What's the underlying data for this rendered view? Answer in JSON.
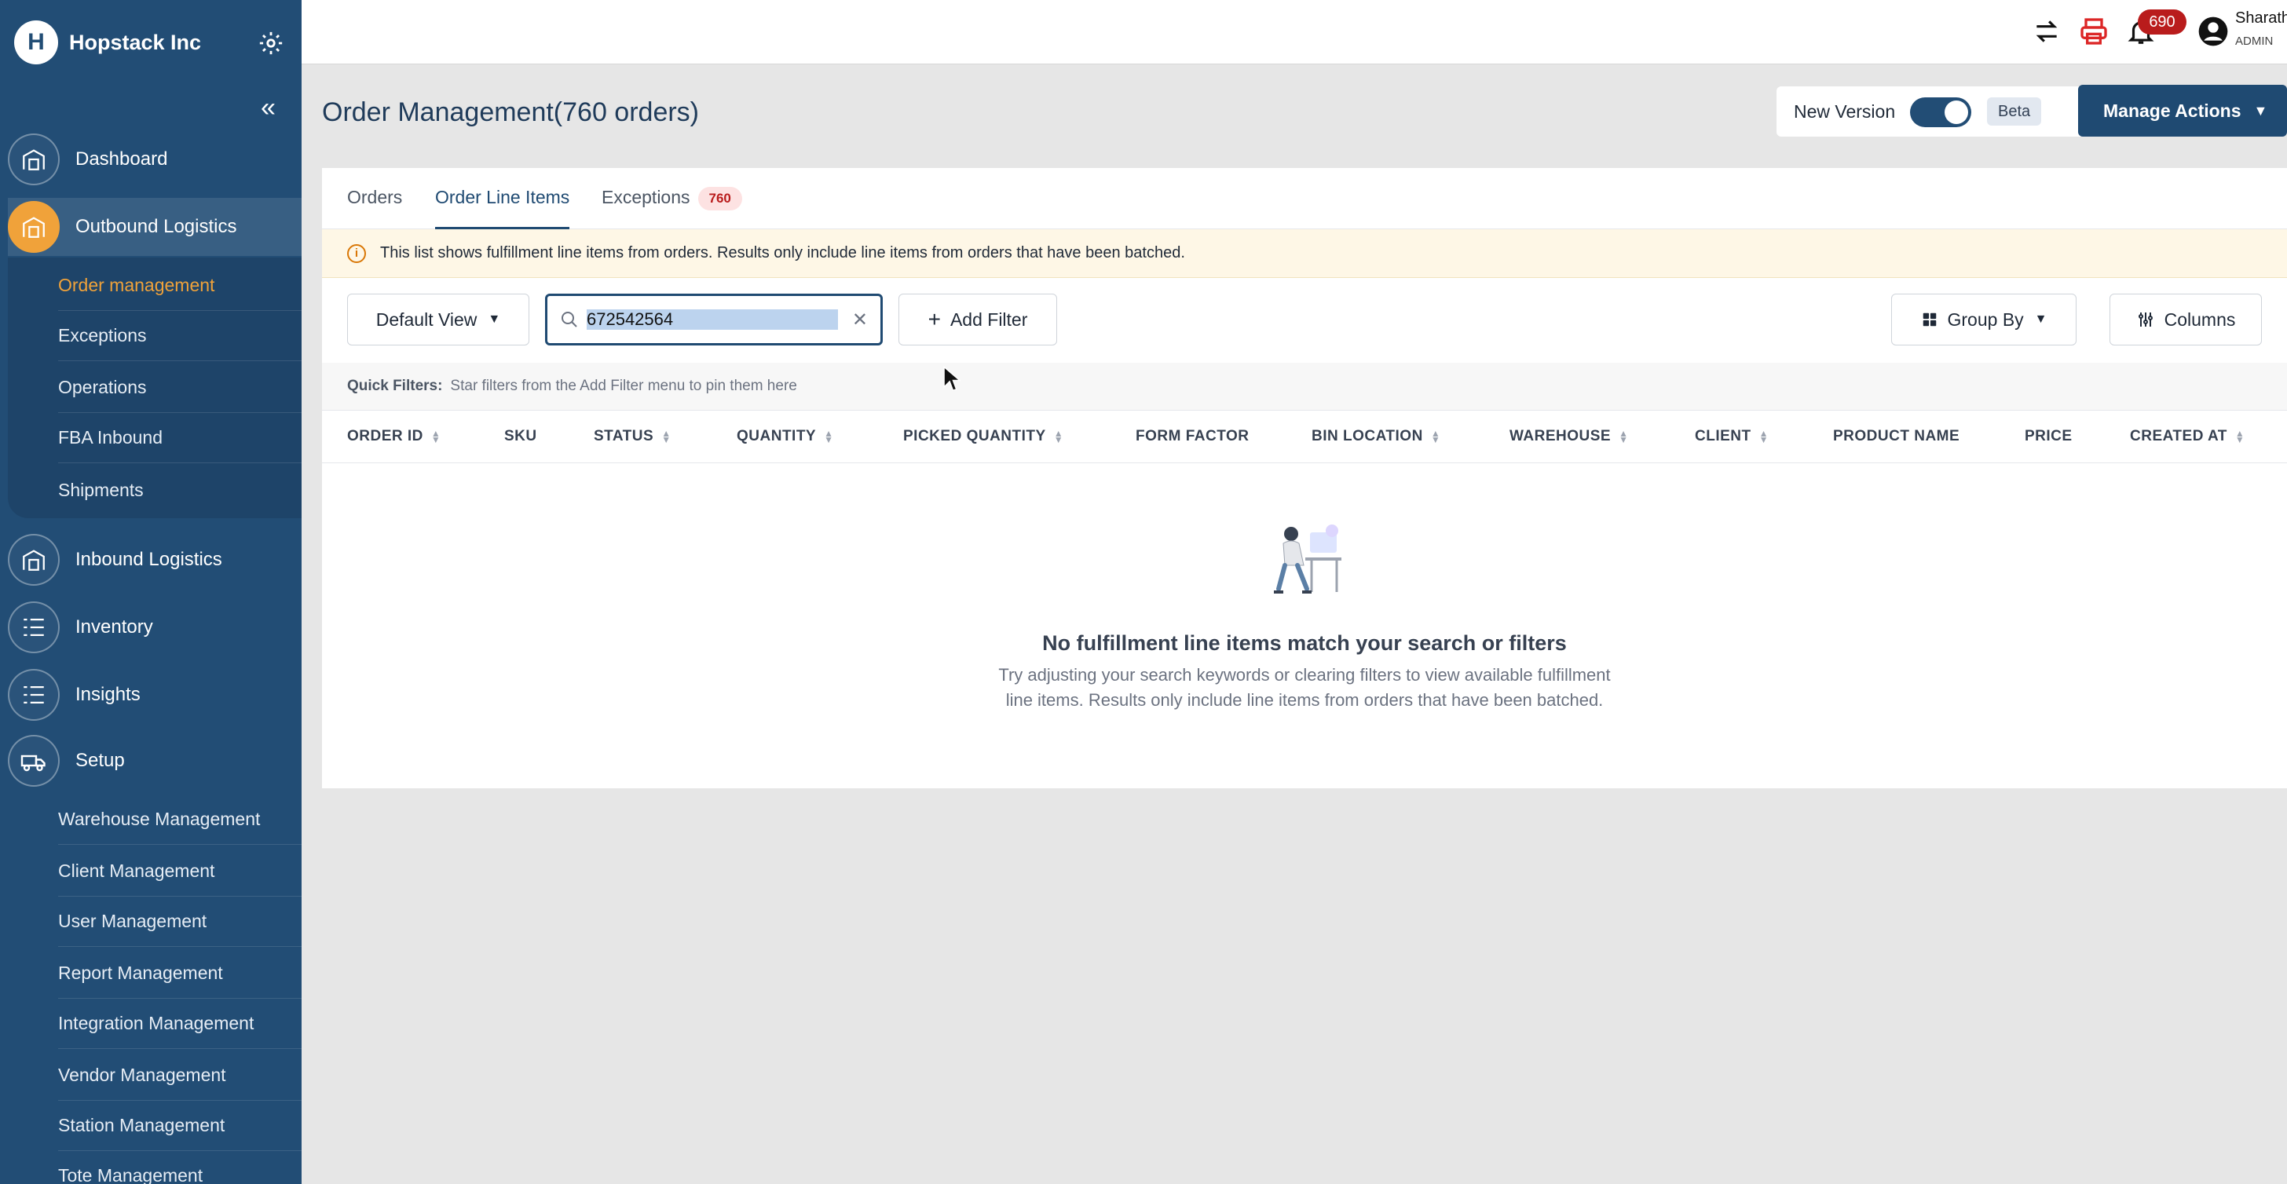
{
  "brand": {
    "name": "Hopstack Inc",
    "logo": "H"
  },
  "sidebar": {
    "collapse_icon": "«",
    "sections": [
      {
        "label": "Dashboard",
        "icon": "warehouse-icon"
      },
      {
        "label": "Outbound Logistics",
        "icon": "warehouse-icon"
      },
      {
        "label": "Inbound Logistics",
        "icon": "warehouse-icon"
      },
      {
        "label": "Inventory",
        "icon": "list-icon"
      },
      {
        "label": "Insights",
        "icon": "list-icon"
      },
      {
        "label": "Setup",
        "icon": "truck-icon"
      }
    ],
    "outbound_items": [
      "Order management",
      "Exceptions",
      "Operations",
      "FBA Inbound",
      "Shipments"
    ],
    "setup_items": [
      "Warehouse Management",
      "Client Management",
      "User Management",
      "Report Management",
      "Integration Management",
      "Vendor Management",
      "Station Management",
      "Tote Management"
    ]
  },
  "topbar": {
    "notification_count": "690",
    "user_name": "Sharath",
    "user_role": "ADMIN"
  },
  "header": {
    "title": "Order Management(760 orders)",
    "version_label": "New Version",
    "beta_label": "Beta",
    "manage_actions": "Manage Actions"
  },
  "tabs": {
    "orders": "Orders",
    "line_items": "Order Line Items",
    "exceptions": "Exceptions",
    "exceptions_count": "760"
  },
  "info": {
    "text": "This list shows fulfillment line items from orders. Results only include line items from orders that have been batched."
  },
  "toolbar": {
    "default_view": "Default View",
    "search_value": "672542564",
    "add_filter": "Add Filter",
    "group_by": "Group By",
    "columns": "Columns"
  },
  "quick_filters": {
    "label": "Quick Filters:",
    "text": "Star filters from the Add Filter menu to pin them here"
  },
  "table": {
    "columns": [
      "ORDER ID",
      "SKU",
      "STATUS",
      "QUANTITY",
      "PICKED QUANTITY",
      "FORM FACTOR",
      "BIN LOCATION",
      "WAREHOUSE",
      "CLIENT",
      "PRODUCT NAME",
      "PRICE",
      "CREATED AT"
    ]
  },
  "empty_state": {
    "title": "No fulfillment line items match your search or filters",
    "description": "Try adjusting your search keywords or clearing filters to view available fulfillment line items. Results only include line items from orders that have been batched."
  },
  "colors": {
    "sidebar": "#224d75",
    "accent": "#f0a23a",
    "primary": "#1f4a72"
  }
}
